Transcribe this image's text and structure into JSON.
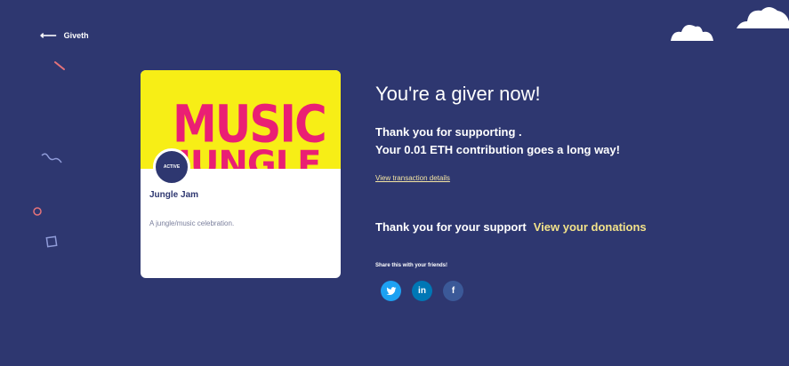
{
  "nav": {
    "back_label": "Giveth",
    "back_icon": "arrow-left-icon"
  },
  "project": {
    "image_text_1": "MUSIC",
    "image_text_2": "JUNGLE",
    "status": "ACTIVE",
    "title": "Jungle Jam",
    "description": "A jungle/music celebration."
  },
  "success": {
    "headline": "You're a giver now!",
    "thanks_line1": "Thank you for supporting .",
    "contrib_prefix": "Your ",
    "amount": "0.01 ETH",
    "contrib_suffix": " contribution goes a long way!",
    "view_tx_label": "View transaction details",
    "support_text": "Thank you for your support",
    "view_donations_label": "View your donations",
    "share_label": "Share this with your friends!"
  },
  "socials": [
    {
      "name": "twitter-icon",
      "color": "#1da1f2"
    },
    {
      "name": "linkedin-icon",
      "color": "#0077b5",
      "glyph": "in"
    },
    {
      "name": "facebook-icon",
      "color": "#3b5998",
      "glyph": "f"
    }
  ],
  "colors": {
    "background": "#2e3770",
    "accent_yellow": "#f2e28a",
    "image_bg": "#f7ee16",
    "image_text": "#ea1f74"
  }
}
